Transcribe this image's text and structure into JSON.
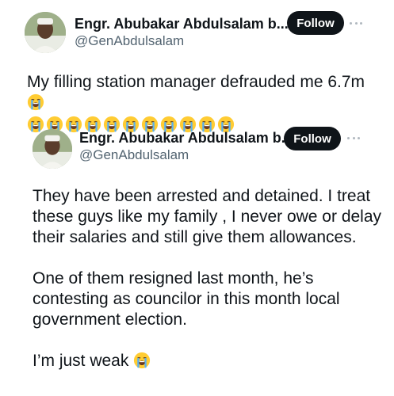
{
  "original_tweet": {
    "author_name": "Engr. Abubakar Abdulsalam b...",
    "author_handle": "@GenAbdulsalam",
    "follow_label": "Follow",
    "text": "My filling station manager defrauded me 6.7m",
    "trailing_emoji": "loudly-crying-face-icon",
    "emoji_row_count": 11
  },
  "quoted_tweet": {
    "author_name": "Engr. Abubakar Abdulsalam b...",
    "author_handle": "@GenAbdulsalam",
    "follow_label": "Follow",
    "paragraphs": [
      "They have been arrested and detained. I treat these guys like my family , I never owe or delay their salaries and still give them allowances.",
      "One of them resigned last month, he’s contesting as councilor in this month local government election.",
      "I’m just weak"
    ],
    "last_paragraph_emoji": "loudly-crying-face-icon"
  },
  "colors": {
    "text": "#0f1419",
    "secondary_text": "#536471",
    "follow_bg": "#0f1419",
    "follow_text": "#ffffff"
  }
}
